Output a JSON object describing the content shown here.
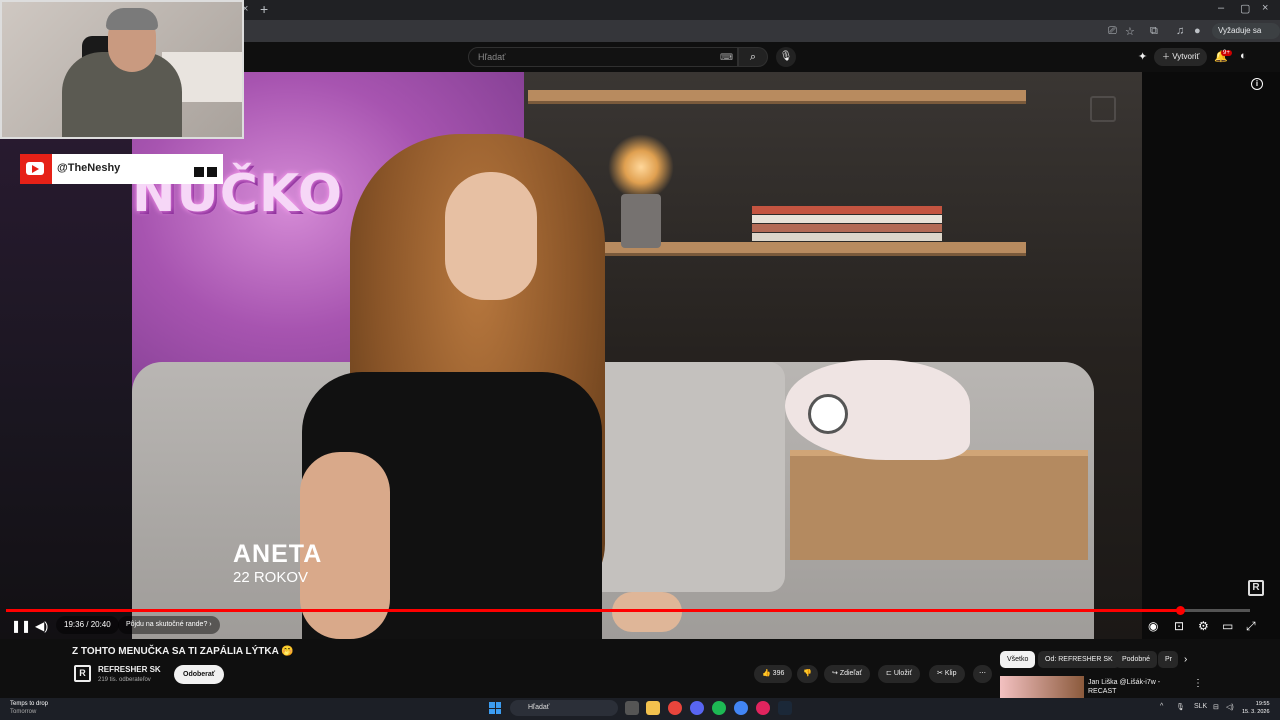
{
  "browser": {
    "tab_close": "×",
    "tab_new": "+",
    "window_controls": [
      "–",
      "▢",
      "×"
    ],
    "profile_pill": "Vyžaduje sa akcia"
  },
  "youtube": {
    "search_placeholder": "Hľadať",
    "create_label": "Vytvoriť",
    "notifications_badge": "9+"
  },
  "overlay": {
    "channel_handle": "@TheNeshy"
  },
  "video": {
    "neon_sign": "NUČKO",
    "guest_name": "ANETA",
    "guest_age": "22 ROKOV",
    "current_time": "19:36 / 20:40",
    "chapter": "Pôjdu na skutočné rande? ›",
    "progress_fraction": 0.944
  },
  "meta": {
    "title": "Z TOHTO MENUČKA SA TI ZAPÁLIA LÝTKA 🤭",
    "channel_name": "REFRESHER SK",
    "channel_subs": "219 tis. odberateľov",
    "subscribe_label": "Odoberať",
    "likes": "396",
    "share_label": "Zdieľať",
    "save_label": "Uložiť",
    "clip_label": "Klip"
  },
  "sidebar": {
    "chips": [
      "Všetko",
      "Od: REFRESHER SK",
      "Podobné",
      "Pr"
    ],
    "recommended_title": "Jan Liška @Lišák-i7w - RECAST"
  },
  "taskbar": {
    "weather_title": "Temps to drop",
    "weather_sub": "Tomorrow",
    "search_label": "Hľadať",
    "lang": "SLK",
    "time": "19:55",
    "date": "15. 3. 2026"
  },
  "colors": {
    "accent": "#ff0000",
    "yt_bg": "#0f0f0f"
  }
}
